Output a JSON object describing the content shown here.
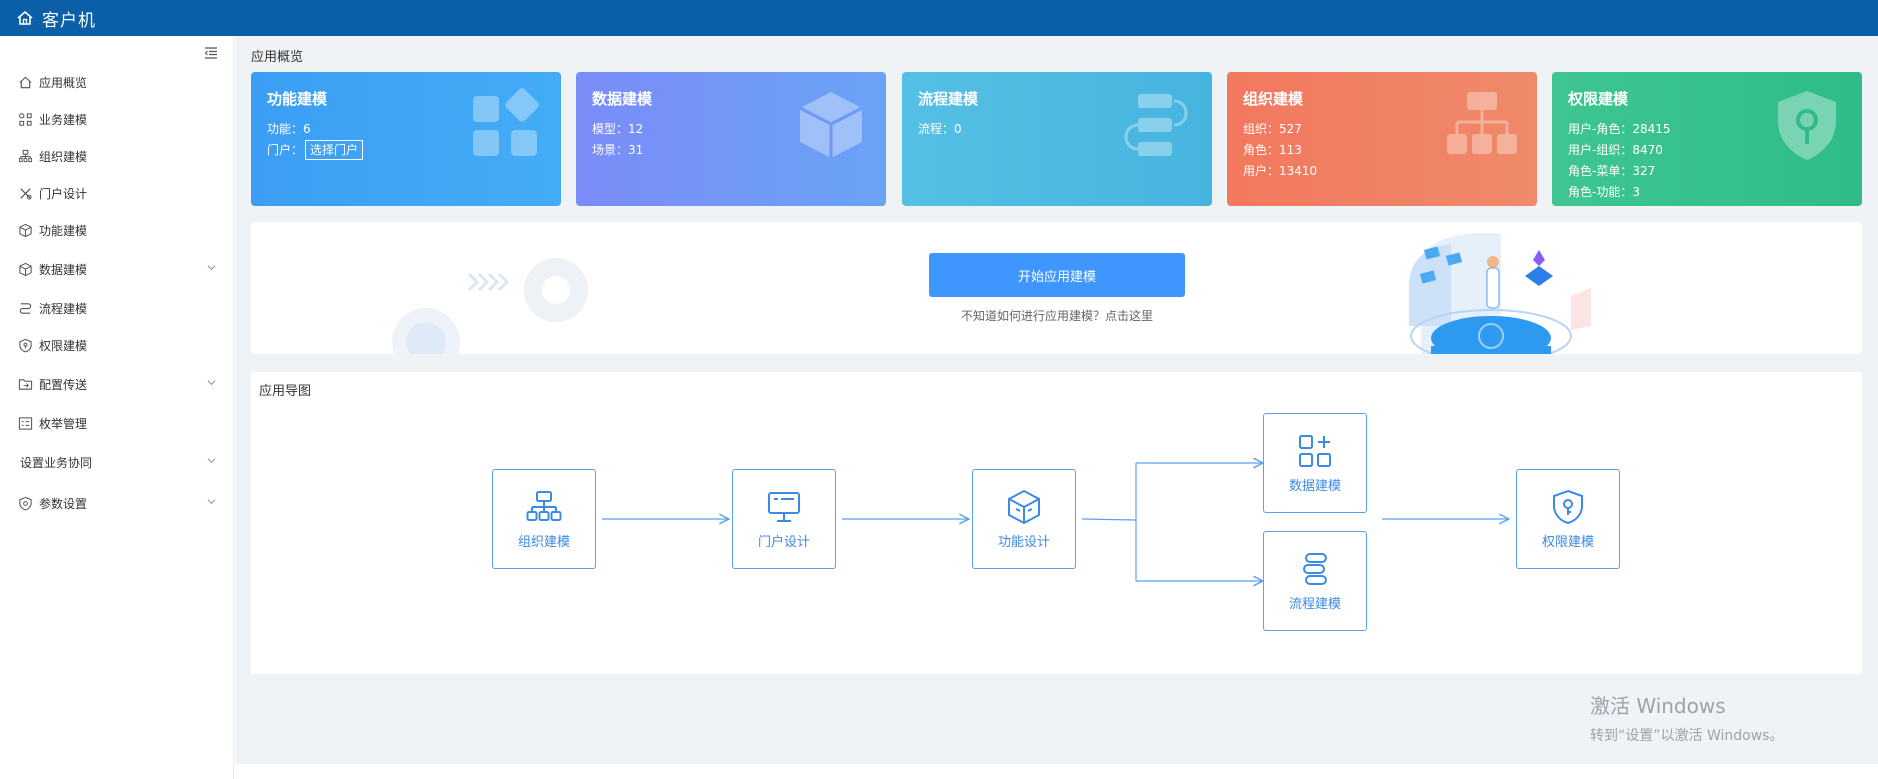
{
  "header": {
    "title": "客户机"
  },
  "sidebar": {
    "items": [
      {
        "label": "应用概览",
        "icon": "home-icon",
        "has_children": false
      },
      {
        "label": "业务建模",
        "icon": "business-model-icon",
        "has_children": false
      },
      {
        "label": "组织建模",
        "icon": "org-icon",
        "has_children": false
      },
      {
        "label": "门户设计",
        "icon": "tools-icon",
        "has_children": false
      },
      {
        "label": "功能建模",
        "icon": "cube-icon",
        "has_children": false
      },
      {
        "label": "数据建模",
        "icon": "data-cube-icon",
        "has_children": true
      },
      {
        "label": "流程建模",
        "icon": "flow-icon",
        "has_children": false
      },
      {
        "label": "权限建模",
        "icon": "shield-icon",
        "has_children": false
      },
      {
        "label": "配置传送",
        "icon": "folder-transfer-icon",
        "has_children": true
      },
      {
        "label": "枚举管理",
        "icon": "enum-icon",
        "has_children": false
      },
      {
        "label": "设置业务协同",
        "icon": "",
        "has_children": true
      },
      {
        "label": "参数设置",
        "icon": "settings-shield-icon",
        "has_children": true
      }
    ]
  },
  "overview": {
    "title": "应用概览",
    "cards": [
      {
        "title": "功能建模",
        "rows": [
          "功能：6"
        ],
        "portal_label": "门户：",
        "portal_button": "选择门户",
        "color": "#3ba4f5"
      },
      {
        "title": "数据建模",
        "rows": [
          "模型：12",
          "场景：31"
        ],
        "color": "#6e8ff9"
      },
      {
        "title": "流程建模",
        "rows": [
          "流程：0"
        ],
        "color": "#4db8e0"
      },
      {
        "title": "组织建模",
        "rows": [
          "组织：527",
          "角色：113",
          "用户：13410"
        ],
        "color": "#f07e61"
      },
      {
        "title": "权限建模",
        "rows": [
          "用户-角色：28415",
          "用户-组织：8470",
          "角色-菜单：327",
          "角色-功能：3"
        ],
        "color": "#36c18c"
      }
    ]
  },
  "banner": {
    "start_button": "开始应用建模",
    "hint": "不知道如何进行应用建模？点击这里"
  },
  "app_map": {
    "title": "应用导图",
    "nodes": {
      "org": "组织建模",
      "portal": "门户设计",
      "func": "功能设计",
      "data": "数据建模",
      "flow": "流程建模",
      "perm": "权限建模"
    }
  },
  "watermark": {
    "line1": "激活 Windows",
    "line2": "转到“设置”以激活 Windows。"
  }
}
